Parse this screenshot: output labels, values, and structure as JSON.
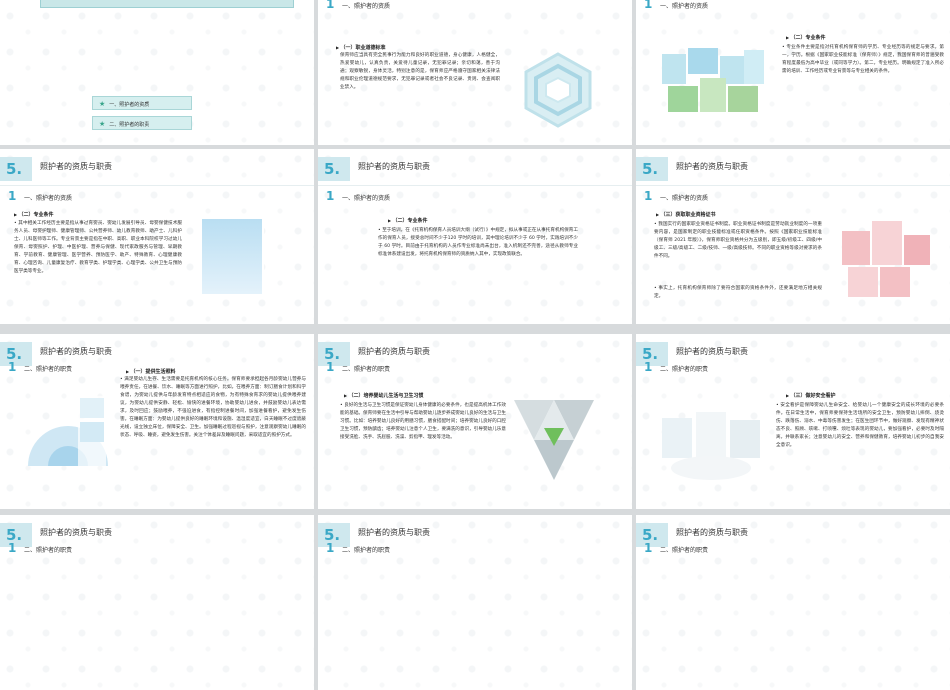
{
  "toc": {
    "items": [
      "一、照护者的资质",
      "二、照护者的职责"
    ]
  },
  "common": {
    "header_num": "5.",
    "header_title": "照护者的资质与职责",
    "sec1_num": "1",
    "sec1_title": "一、照护者的资质",
    "sec2_num": "1",
    "sec2_title": "二、照护者的职责"
  },
  "slides": {
    "s2": {
      "sub": "（一）职业道德标准",
      "text": "保育师应当具有完全民事行为能力和良好的职业道德，身心健康，人格健全，热爱婴幼儿，认真负责，关爱待儿童记录，无犯罪记录；亲切和蔼，善于沟通；观察敏锐，身体灵活，特别注意的是，保育师应严格遵守国家相关法律法规和职业伦理道德规范要求，无犯罪记录或者社会不良记录、贵则、会查阅职业禁入。"
    },
    "s3": {
      "sub": "（二）专业条件",
      "text": "专业条件主要是指对托育机构保育师的学历、专业经历等的规定与要求。第一，学历。根据《国家职业技能标准（保育师）》规定，我国保育师的普遍受教育程度最低为高中毕业（或同等学力）。第二，专业经历。明确规定了准入所必需的培训、工作经历或专业背景等与专业相关的条件。"
    },
    "s4": {
      "sub": "（二）专业条件",
      "text": "其中相关工作经历主要是指从事过育婴员、婴幼儿发展引导员、母婴保健技术服务人员、母婴护理师、健康管理师、公共营养师、幼儿教育教师、助产士、儿科护士、儿科医师等工作。专业背景主要是指在中职、高职、职业本科院校学习过幼儿保育、母婴照护、护理、中医护理、营养与保健、现代家政服务与管理、早期教育、学前教育、健康管理、医学营养、预防医学、助产、特殊教育、心理健康教育、心理咨询、儿童康复治疗、教育学类、护理学类、心理学类、公共卫生与预防医学类等专业。"
    },
    "s5": {
      "sub": "（二）专业条件",
      "text": "至于培训，在《托育机构保育人员培训大纲（试行）》中规定，拟从事或正在从事托育机构保育工作的保育人员，接受总时间不少于120 学时的培训，其中理论培训不少于 60 学时，实践培训不少于 60 学时。目前由于托育机构的人员作专业标准尚未出台，准入机制还不完善，途径从教师专业标准体系建设出发，将托育机构保育师的资质纳入其中，实现政策联合。"
    },
    "s6": {
      "sub": "（三）获取职业资格证书",
      "text1": "我国实行的国家职业资格证书制度。职业资格证书制度是劳动就业制度的一项重要内容，是国家制定的职业技能标准或任职资格条件。按照《国家职业技能标准（保育师 2021 年版）》，保育师职业资格共分为五级别，即五级/初级工、四级/中级工、三级/高级工、二级/技师、一级/高级技师。不同的职业资格等级对要求的条件不同。",
      "text2": "事实上，托育机构保育师除了要符合国家的资格条件外，还要满足地方相关规定。"
    },
    "s7": {
      "sub": "（一）提供生活照料",
      "text": "满足婴幼儿生存、生活需要是托育机构的核心任务。保育师要承担起各月龄婴幼儿营养与喂养责任，在进餐、饮水、睡眠等方面进行照护，比如，在喂养方面：制订膳食计划和科学食谱，为婴幼儿提供与年龄发育特点相适应的食物，为有特殊食育求的婴幼儿提供喂养建议，为婴幼儿提供安静、轻松、愉快的进餐环境，协助婴幼儿进食，并鼓励婴幼儿表达需求，及时回应；鼓励喂养，不强迫进食，有指控制进餐时间，加强进餐看护，避免发生伤害。在睡眠方面：为婴幼儿提供良好的睡眠环境和设施、温湿度适宜，白天睡眠不过度遮蔽光线，设立独立床位，保障安全、卫生。加强睡眠过程巡视与照护，注意观察婴幼儿睡眠的状态、呼吸、睡姿，避免发生伤害。关注个体差异及睡眠问题，采取适宜的照护方式。"
    },
    "s8": {
      "sub": "（二）培养婴幼儿生活与卫生习惯",
      "text": "良好的生活与卫生习惯是保证婴幼儿身体健康的必要条件，也是提高机体工作效能的基础。保育师要在生活中引导与帮助婴幼儿逐步养成婴幼儿良好的生活与卫生习惯。比如：培养婴幼儿良好的用膳习惯，膳食搭配时间；培养婴幼儿良好的口腔卫生习惯，预防龋齿；培养婴幼儿注意个人卫生，要满洗的意识，引导婴幼儿乐意接受洗脸、洗手、洗屁股、洗澡、剪指甲、理发等活动。"
    },
    "s9": {
      "sub": "（三）做好安全看护",
      "text": "安全看护是保障婴幼儿生命安全、给婴幼儿一个健康安全的成长环境的必要条件。在日常生活中，保育师要保持生活场所的安全卫生，预防婴幼儿摔倒、烧烫伤、跌落伤、溺水、中毒等伤害发生；在医生团环节中，做好观察、发现有精神状态不良、照顾、咳嗽、打喷嚏、烦吐等表现的婴幼儿，要加强看护，必要时及时隔离，并联系家长；注意婴幼儿的安全、营养和保健教育，培养婴幼儿初步的自我安全意识。"
    }
  }
}
